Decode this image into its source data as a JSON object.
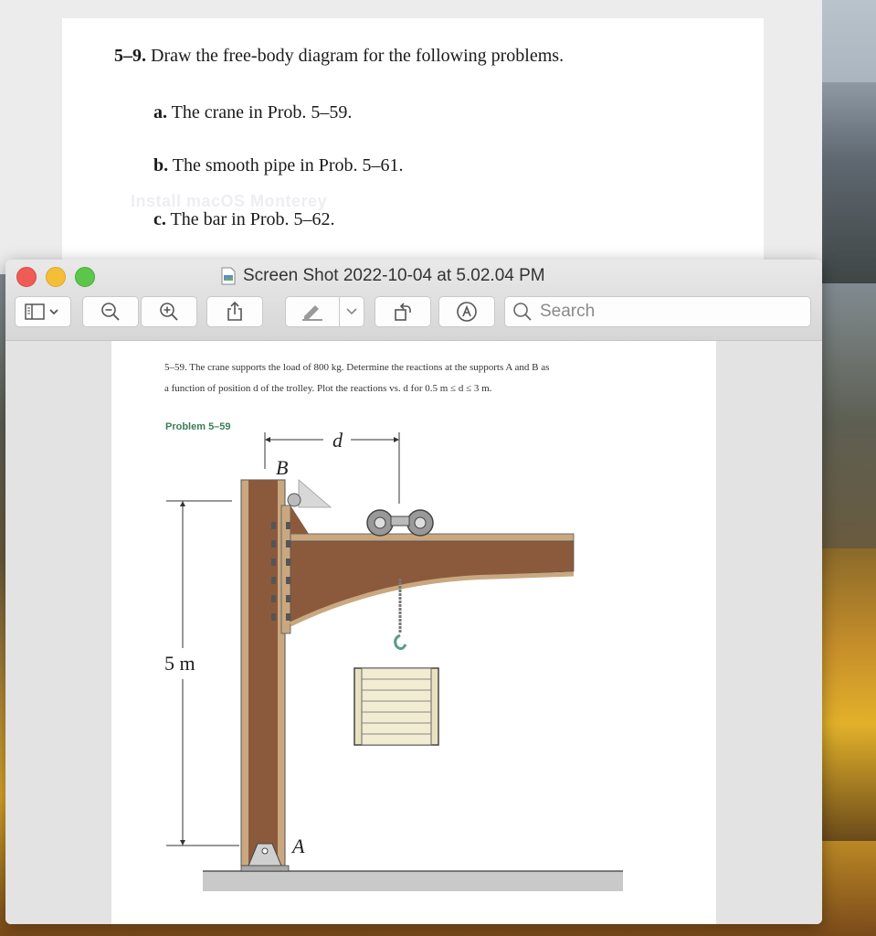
{
  "background_document": {
    "heading_number": "5–9.",
    "heading_text": "Draw the free-body diagram for the following problems.",
    "items": [
      {
        "letter": "a.",
        "text": "The crane in Prob. 5–59."
      },
      {
        "letter": "b.",
        "text": "The smooth pipe in Prob. 5–61."
      },
      {
        "letter": "c.",
        "text": "The bar in Prob. 5–62."
      }
    ],
    "watermark": "Install macOS Monterey"
  },
  "preview_window": {
    "title": "Screen Shot 2022-10-04 at 5.02.04 PM",
    "toolbar": {
      "sidebar_icon": "sidebar-icon",
      "zoom_out_icon": "zoom-out-icon",
      "zoom_in_icon": "zoom-in-icon",
      "share_icon": "share-icon",
      "markup_icon": "pen-icon",
      "rotate_icon": "rotate-icon",
      "annotate_icon": "annotate-icon",
      "search_placeholder": "Search"
    }
  },
  "problem": {
    "line1": "5–59. The crane supports the load of 800 kg. Determine the reactions at the supports A and B as",
    "line2": "a function of position d of the trolley. Plot the reactions vs. d for 0.5 m ≤ d ≤ 3 m.",
    "label": "Problem 5–59",
    "figure": {
      "dimension_d": "d",
      "label_b": "B",
      "label_a": "A",
      "height_label": "5 m"
    }
  },
  "colors": {
    "close": "#ee5c55",
    "minimize": "#f5be37",
    "maximize": "#5cc64b",
    "problem_label": "#3b7d58",
    "steel": "#8b5a3c"
  }
}
